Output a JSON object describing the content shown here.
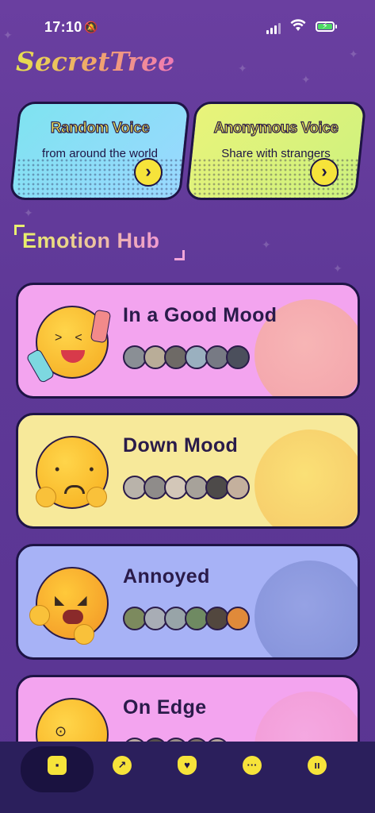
{
  "status_bar": {
    "time": "17:10"
  },
  "app": {
    "logo": "SecretTree"
  },
  "feature_cards": [
    {
      "title": "Random Voice",
      "subtitle": "from around the world",
      "color": "#8fe0f4",
      "icon": "chevron-right-icon"
    },
    {
      "title": "Anonymous Voice",
      "subtitle": "Share with strangers",
      "color": "#dff27c",
      "icon": "chevron-right-icon"
    }
  ],
  "section": {
    "title": "Emotion Hub"
  },
  "moods": [
    {
      "title": "In a Good Mood",
      "color": "#f3a4ef",
      "emoji": "laughing-emoji-icon"
    },
    {
      "title": "Down Mood",
      "color": "#f7e99a",
      "emoji": "sad-emoji-icon"
    },
    {
      "title": "Annoyed",
      "color": "#a7b2f6",
      "emoji": "angry-emoji-icon"
    },
    {
      "title": "On Edge",
      "color": "#f3a4ef",
      "emoji": "anxious-emoji-icon"
    }
  ],
  "nav": {
    "items": [
      {
        "icon": "home-icon",
        "active": true
      },
      {
        "icon": "compass-icon",
        "active": false
      },
      {
        "icon": "heart-icon",
        "active": false
      },
      {
        "icon": "chat-icon",
        "active": false
      },
      {
        "icon": "profile-icon",
        "active": false
      }
    ]
  }
}
